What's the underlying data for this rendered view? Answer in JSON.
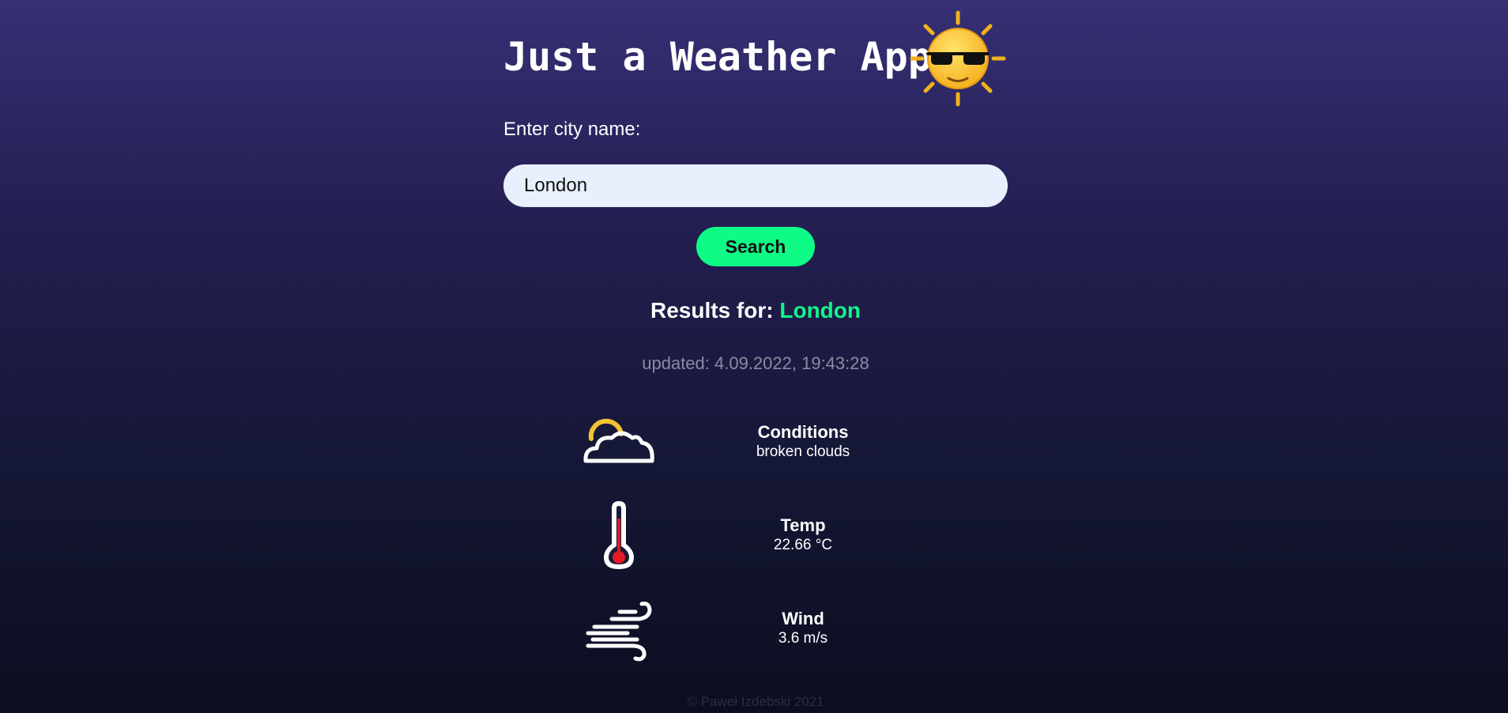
{
  "app": {
    "title": "Just a Weather App",
    "logo_icon": "sunglasses-sun-icon"
  },
  "search": {
    "label": "Enter city name:",
    "value": "London",
    "placeholder": "",
    "button_label": "Search"
  },
  "results": {
    "prefix": "Results for:",
    "city": "London",
    "updated": "updated: 4.09.2022, 19:43:28"
  },
  "stats": [
    {
      "icon": "partly-cloudy-icon",
      "title": "Conditions",
      "value": "broken clouds"
    },
    {
      "icon": "thermometer-icon",
      "title": "Temp",
      "value": "22.66 °C"
    },
    {
      "icon": "wind-icon",
      "title": "Wind",
      "value": "3.6 m/s"
    }
  ],
  "footer": {
    "text": "© Paweł Izdebski 2021"
  },
  "colors": {
    "accent": "#0efb86",
    "city_highlight": "#14f38a",
    "input_background": "#e8f0fe",
    "muted_text": "#8e8aa3"
  }
}
